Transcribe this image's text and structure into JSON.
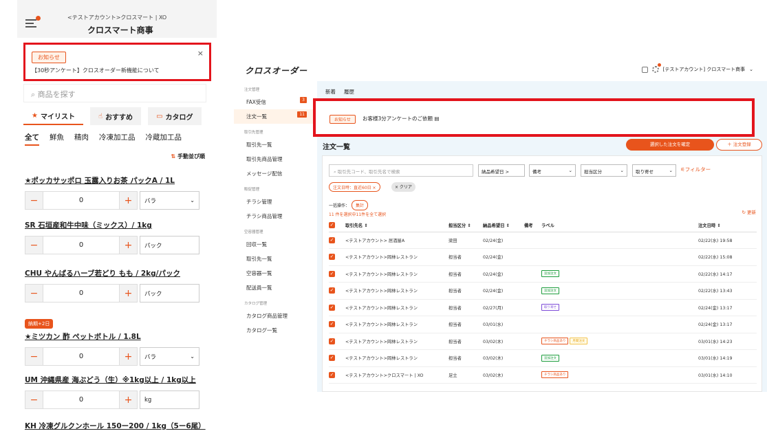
{
  "mobile": {
    "subtitle": "<テストアカウント>クロスマート | XO",
    "title": "クロスマート商事",
    "notice": {
      "badge": "お知らせ",
      "text": "【30秒アンケート】クロスオーダー新機能について",
      "close": "×"
    },
    "search_placeholder": "商品を探す",
    "tabs": [
      "マイリスト",
      "おすすめ",
      "カタログ"
    ],
    "cats": [
      "全て",
      "鮮魚",
      "精肉",
      "冷凍加工品",
      "冷蔵加工品"
    ],
    "sort": "手動並び順",
    "products": [
      {
        "name": "★ポッカサッポロ 玉露入りお茶 パックA / 1L",
        "qty": "0",
        "unit": "バラ",
        "dd": true,
        "delay": ""
      },
      {
        "name": "SR 石垣産和牛中味（ミックス）/ 1kg",
        "qty": "0",
        "unit": "パック",
        "dd": false,
        "delay": ""
      },
      {
        "name": "CHU やんばるハーブ若どり もも / 2kg/パック",
        "qty": "0",
        "unit": "パック",
        "dd": false,
        "delay": ""
      },
      {
        "name": "★ミツカン 酢 ペットボトル / 1.8L",
        "qty": "0",
        "unit": "バラ",
        "dd": true,
        "delay": "納期+2日"
      },
      {
        "name": "UM 沖縄県産 海ぶどう（生）※1kg以上 / 1kg以上",
        "qty": "0",
        "unit": "kg",
        "dd": false,
        "delay": ""
      },
      {
        "name": "KH 冷凍グルクンホール 150ー200 / 1kg（5ー6尾）",
        "qty": "",
        "unit": "",
        "dd": false,
        "delay": ""
      }
    ]
  },
  "desktop": {
    "brand": "クロスオーダー",
    "account": "[テストアカウント] クロスマート商事",
    "sidebar": [
      {
        "group": "注文管理",
        "items": [
          {
            "label": "FAX受信",
            "count": "3"
          },
          {
            "label": "注文一覧",
            "count": "11",
            "active": true
          }
        ]
      },
      {
        "group": "取引先管理",
        "items": [
          {
            "label": "取引先一覧"
          },
          {
            "label": "取引先商品管理"
          },
          {
            "label": "メッセージ配信"
          }
        ]
      },
      {
        "group": "販促管理",
        "items": [
          {
            "label": "チラシ管理"
          },
          {
            "label": "チラシ商品管理"
          }
        ]
      },
      {
        "group": "空容器管理",
        "items": [
          {
            "label": "回収一覧"
          },
          {
            "label": "取引先一覧"
          },
          {
            "label": "空容器一覧"
          },
          {
            "label": "配送員一覧"
          }
        ]
      },
      {
        "group": "カタログ管理",
        "items": [
          {
            "label": "カタログ商品管理"
          },
          {
            "label": "カタログ一覧"
          }
        ]
      }
    ],
    "toptabs": [
      "新着",
      "履歴"
    ],
    "notice": {
      "badge": "お知らせ",
      "text": "お客様3分アンケートのご依頼"
    },
    "page_title": "注文一覧",
    "confirm": "選択した注文を確定",
    "register": "＋ 注文登録",
    "search_placeholder": "取引先コード、取引先名で検索",
    "filters": [
      "納品希望日 >",
      "備考",
      "担当区分",
      "取り寄せ"
    ],
    "filter_link": "フィルター",
    "chips": [
      "注文日時：直近60日 ×",
      "× クリア"
    ],
    "bulk_label": "一括操作：",
    "bulk_btn": "集計",
    "selection": "11 件を選択中11件を全て選択",
    "refresh": "更新",
    "headers": [
      "取引先名 ⇕",
      "担当区分 ⇕",
      "納品希望日 ⇕",
      "備考",
      "ラベル",
      "注文日時 ⇕"
    ],
    "rows": [
      {
        "name": "<テストアカウント> 居酒屋A",
        "tanto": "梁田",
        "date": "02/24(金)",
        "labels": [],
        "ordered": "02/22(水) 19:58"
      },
      {
        "name": "<テストアカウント>岡林レストラン",
        "tanto": "担当者",
        "date": "02/24(金)",
        "labels": [],
        "ordered": "02/22(水) 15:08"
      },
      {
        "name": "<テストアカウント>岡林レストラン",
        "tanto": "担当者",
        "date": "02/24(金)",
        "labels": [
          {
            "t": "追加注文",
            "c": "green"
          }
        ],
        "ordered": "02/22(水) 14:17"
      },
      {
        "name": "<テストアカウント>岡林レストラン",
        "tanto": "担当者",
        "date": "02/24(金)",
        "labels": [
          {
            "t": "追加注文",
            "c": "green"
          }
        ],
        "ordered": "02/22(水) 13:43"
      },
      {
        "name": "<テストアカウント>岡林レストラン",
        "tanto": "担当者",
        "date": "02/27(月)",
        "labels": [
          {
            "t": "取り寄せ",
            "c": "purple"
          }
        ],
        "ordered": "02/24(金) 13:17"
      },
      {
        "name": "<テストアカウント>岡林レストラン",
        "tanto": "担当者",
        "date": "03/01(水)",
        "labels": [],
        "ordered": "02/24(金) 13:17"
      },
      {
        "name": "<テストアカウント>岡林レストラン",
        "tanto": "担当者",
        "date": "03/02(木)",
        "labels": [
          {
            "t": "チラシ商品あり",
            "c": "orange"
          },
          {
            "t": "月間注文",
            "c": "yellow"
          }
        ],
        "ordered": "03/01(水) 14:23"
      },
      {
        "name": "<テストアカウント>岡林レストラン",
        "tanto": "担当者",
        "date": "03/02(木)",
        "labels": [
          {
            "t": "追加注文",
            "c": "green"
          }
        ],
        "ordered": "03/01(水) 14:19"
      },
      {
        "name": "<テストアカウント>クロスマート | XO",
        "tanto": "足立",
        "date": "03/02(木)",
        "labels": [
          {
            "t": "チラシ商品あり",
            "c": "orange"
          }
        ],
        "ordered": "03/01(水) 14:10"
      }
    ]
  }
}
